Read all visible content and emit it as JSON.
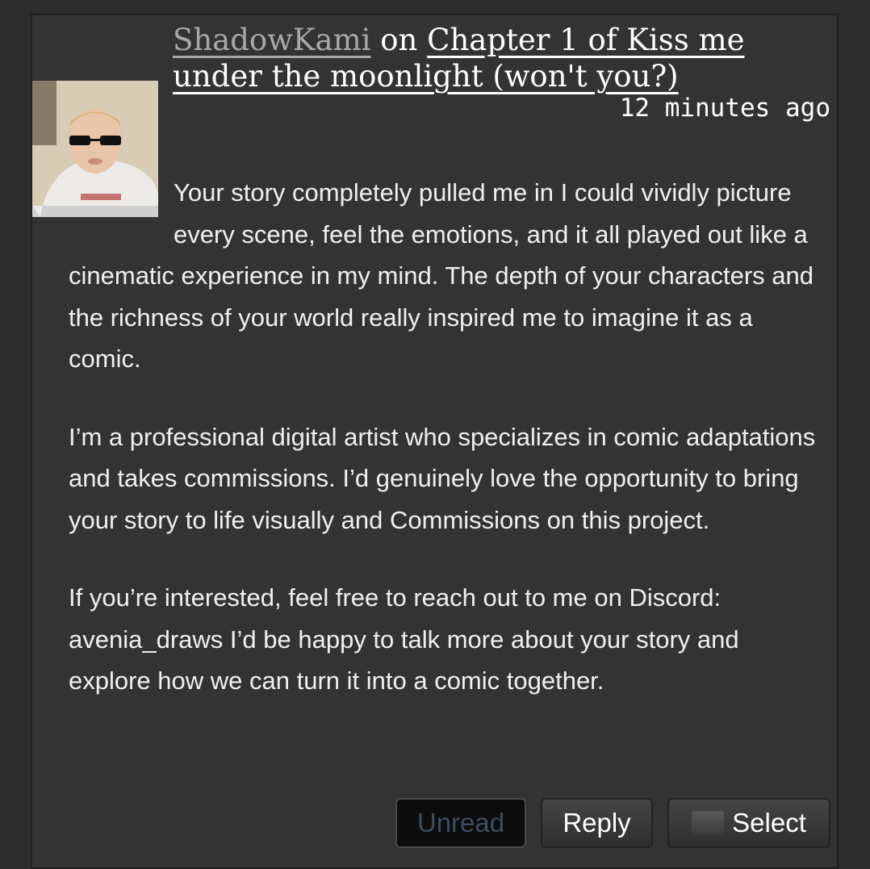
{
  "comment": {
    "author": "ShadowKami",
    "connector": "on",
    "chapter_link": "Chapter 1 of Kiss me under the moonlight (won't you?)",
    "timestamp": "12 minutes ago",
    "paragraphs": [
      "Your story completely pulled me in I could vividly picture every scene, feel the emotions, and it all played out like a cinematic experience in my mind. The depth of your characters and the richness of your world really inspired me to imagine it as a comic.",
      "I’m a professional digital artist who specializes in comic adaptations and takes commissions. I’d genuinely love the opportunity to bring your story to life visually and Commissions on this project.",
      "If you’re interested, feel free to reach out to me on Discord: avenia_draws I’d be happy to talk more about your story and explore how we can turn it into a comic together."
    ]
  },
  "actions": {
    "unread_label": "Unread",
    "reply_label": "Reply",
    "select_label": "Select"
  },
  "colors": {
    "background": "#333333",
    "author_link": "#a8a8a8",
    "unread_text": "#3b4c63"
  }
}
